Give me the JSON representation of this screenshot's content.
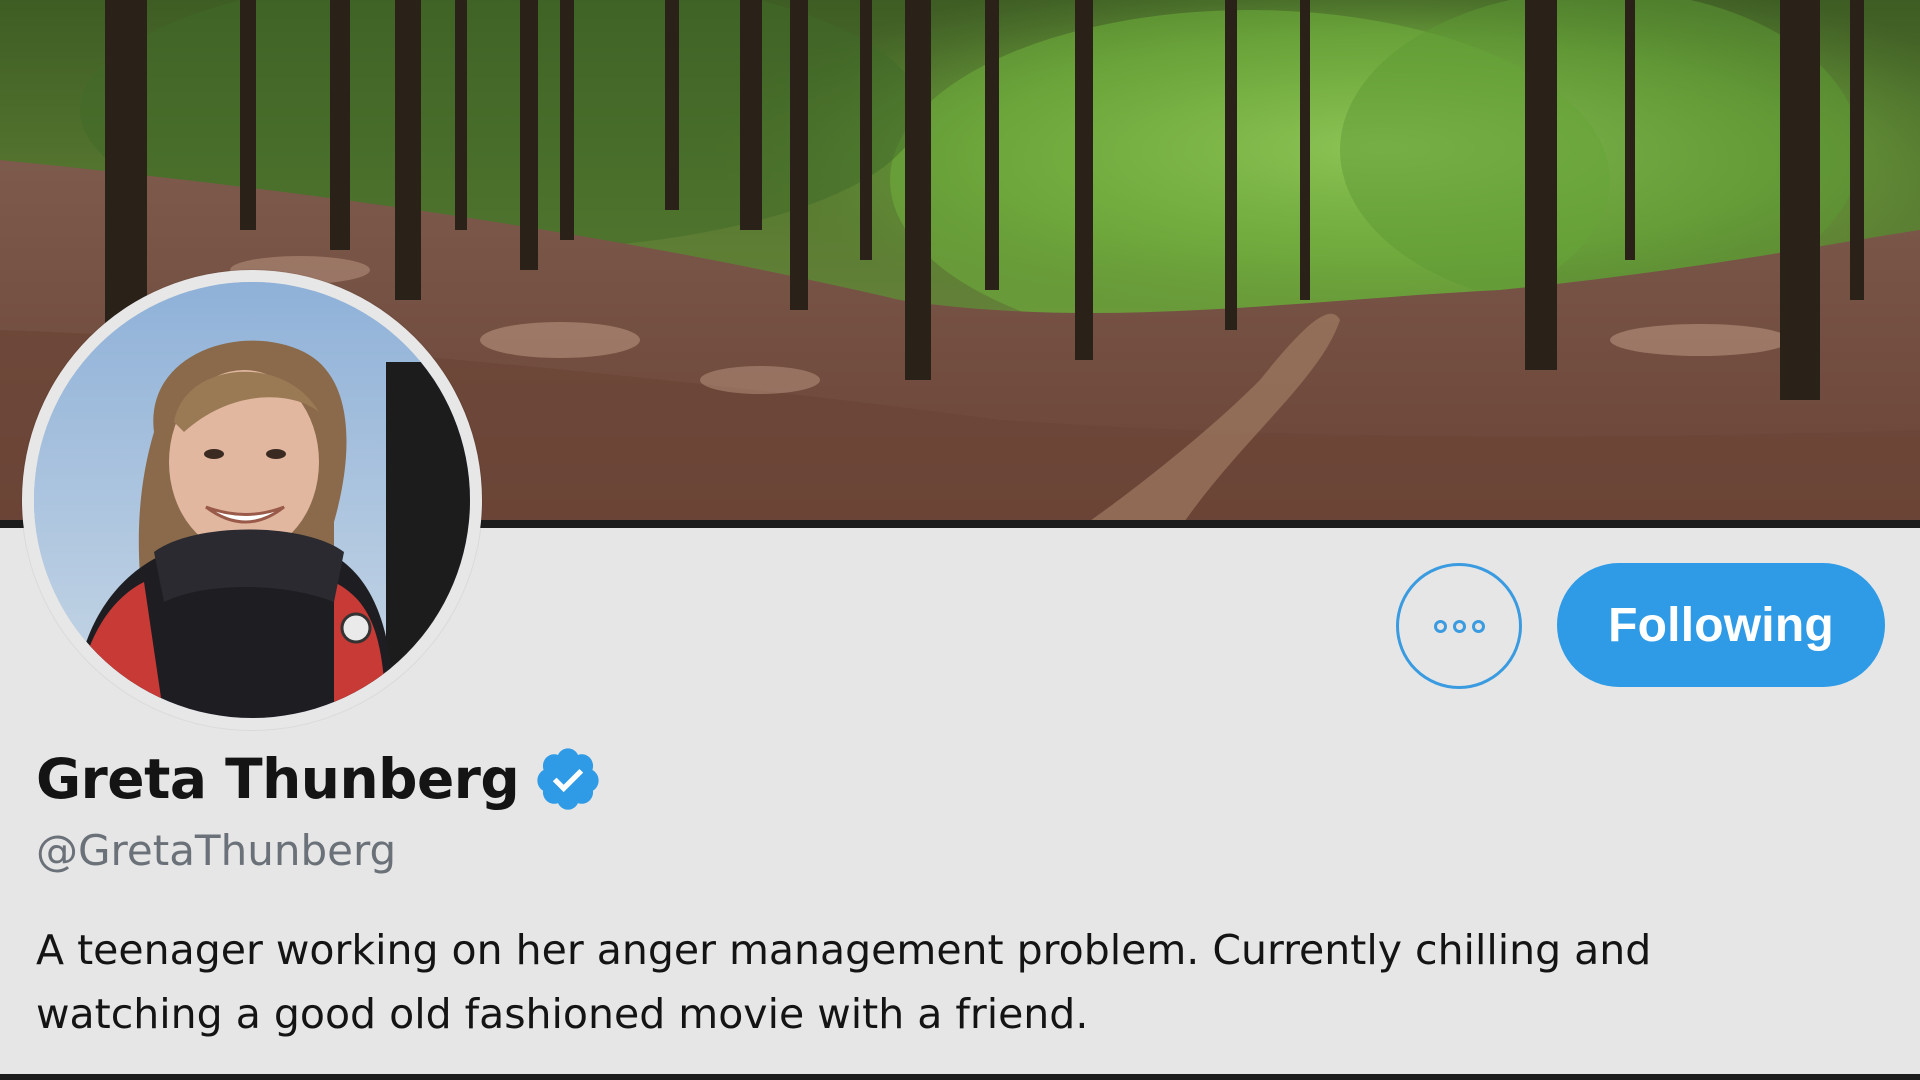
{
  "profile": {
    "display_name": "Greta Thunberg",
    "handle": "@GretaThunberg",
    "verified": true,
    "bio_lines": [
      "A teenager working on her anger management problem. Currently chilling and",
      "watching a good old fashioned movie with a friend."
    ]
  },
  "actions": {
    "more_icon": "more-horizontal-icon",
    "following_label": "Following"
  },
  "icons": {
    "verified": "verified-badge-icon"
  },
  "colors": {
    "accent": "#2f9be6",
    "profile_background": "#e6e6e6",
    "name_text": "#141414",
    "handle_text": "#6b7178"
  }
}
